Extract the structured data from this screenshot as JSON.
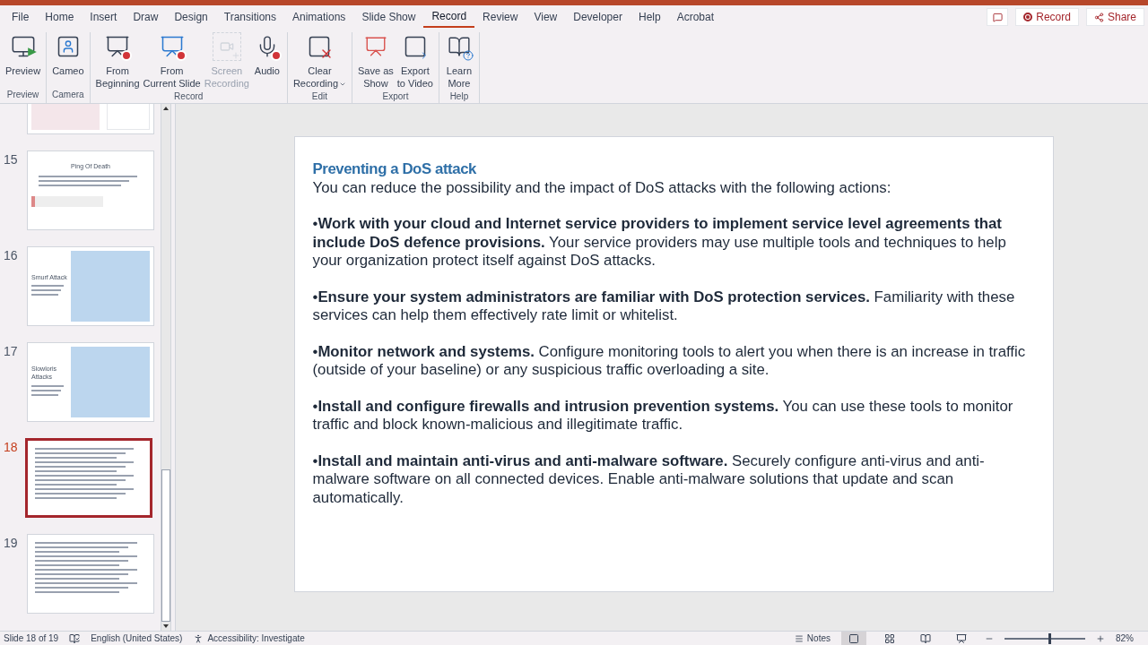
{
  "menu_tabs": [
    {
      "label": "File",
      "selected": false
    },
    {
      "label": "Home",
      "selected": false
    },
    {
      "label": "Insert",
      "selected": false
    },
    {
      "label": "Draw",
      "selected": false
    },
    {
      "label": "Design",
      "selected": false
    },
    {
      "label": "Transitions",
      "selected": false
    },
    {
      "label": "Animations",
      "selected": false
    },
    {
      "label": "Slide Show",
      "selected": false
    },
    {
      "label": "Record",
      "selected": true
    },
    {
      "label": "Review",
      "selected": false
    },
    {
      "label": "View",
      "selected": false
    },
    {
      "label": "Developer",
      "selected": false
    },
    {
      "label": "Help",
      "selected": false
    },
    {
      "label": "Acrobat",
      "selected": false
    }
  ],
  "top_buttons": {
    "record": "Record",
    "share": "Share"
  },
  "ribbon_groups": [
    {
      "name": "Preview",
      "buttons": [
        {
          "kind": "preview",
          "lines": [
            "Preview"
          ],
          "disabled": false
        }
      ]
    },
    {
      "name": "Camera",
      "buttons": [
        {
          "kind": "cameo",
          "lines": [
            "Cameo"
          ],
          "disabled": false
        }
      ]
    },
    {
      "name": "Record",
      "buttons": [
        {
          "kind": "from_beginning",
          "lines": [
            "From",
            "Beginning"
          ],
          "disabled": false
        },
        {
          "kind": "from_current",
          "lines": [
            "From",
            "Current Slide"
          ],
          "disabled": false
        },
        {
          "kind": "screen",
          "lines": [
            "Screen",
            "Recording"
          ],
          "disabled": true
        },
        {
          "kind": "audio",
          "lines": [
            "Audio"
          ],
          "disabled": false
        }
      ]
    },
    {
      "name": "Edit",
      "buttons": [
        {
          "kind": "clear",
          "lines": [
            "Clear",
            "Recording"
          ],
          "disabled": false,
          "dropdown": true
        }
      ]
    },
    {
      "name": "Export",
      "buttons": [
        {
          "kind": "save_show",
          "lines": [
            "Save as",
            "Show"
          ],
          "disabled": false
        },
        {
          "kind": "export_video",
          "lines": [
            "Export",
            "to Video"
          ],
          "disabled": false
        }
      ]
    },
    {
      "name": "Help",
      "buttons": [
        {
          "kind": "learn",
          "lines": [
            "Learn",
            "More"
          ],
          "disabled": false
        }
      ]
    }
  ],
  "thumbnails": [
    {
      "kind": "diagram",
      "selected": false
    },
    {
      "number": "15",
      "kind": "title_text",
      "title": "Ping Of Death",
      "selected": false
    },
    {
      "number": "16",
      "kind": "side_title",
      "title": "Smurf Attack",
      "selected": false
    },
    {
      "number": "17",
      "kind": "side_title",
      "title": "Slowloris Attacks",
      "selected": false
    },
    {
      "number": "18",
      "kind": "text",
      "selected": true
    },
    {
      "number": "19",
      "kind": "text",
      "selected": false
    }
  ],
  "slide": {
    "heading": "Preventing a DoS attack",
    "intro": "You can reduce the possibility and the impact of DoS attacks with the following actions:",
    "bullets": [
      "•**Work with your cloud and Internet service providers to implement service level agreements that include DoS defence provisions.** Your service providers may use multiple tools and techniques to help your organization protect itself against DoS attacks.",
      "•**Ensure your system administrators are familiar with DoS protection services.** Familiarity with these services can help them effectively rate limit or whitelist.",
      "•**Monitor network and systems.** Configure monitoring tools to alert you when there is an increase in traffic (outside of your baseline) or any suspicious traffic overloading a site.",
      "•**Install and configure firewalls and intrusion prevention systems.** You can use these tools to monitor traffic and block known-malicious and illegitimate traffic.",
      "•**Install and maintain anti-virus and anti-malware software.** Securely configure anti-virus and anti-malware software on all connected devices. Enable anti-malware solutions that update and scan automatically."
    ]
  },
  "status_bar": {
    "slide_info": "Slide 18 of 19",
    "language": "English (United States)",
    "accessibility": "Accessibility: Investigate",
    "notes": "Notes",
    "views": [
      {
        "kind": "normal",
        "selected": true
      },
      {
        "kind": "sorter",
        "selected": false
      },
      {
        "kind": "reading",
        "selected": false
      },
      {
        "kind": "show",
        "selected": false
      }
    ],
    "zoom": {
      "level": 0.55,
      "label": "82%"
    }
  }
}
